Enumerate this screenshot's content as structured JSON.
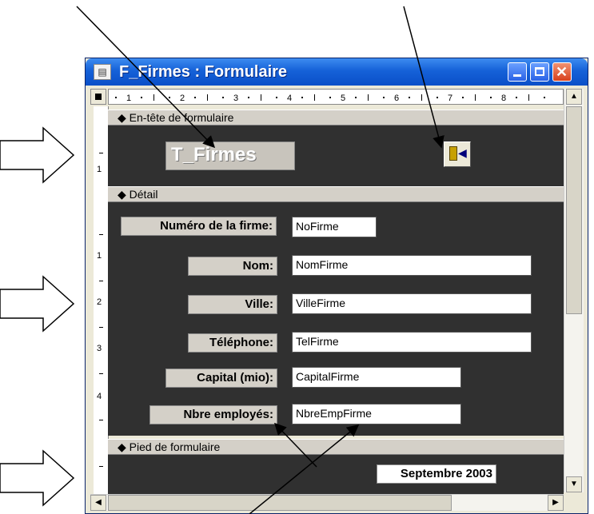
{
  "window": {
    "title": "F_Firmes : Formulaire",
    "icon": "form-icon"
  },
  "ruler": {
    "ticks": [
      "1",
      "2",
      "3",
      "4",
      "5",
      "6",
      "7",
      "8"
    ],
    "vticks": [
      "1",
      "1",
      "2",
      "3",
      "4"
    ]
  },
  "sections": {
    "header": "En-tête de formulaire",
    "detail": "Détail",
    "footer": "Pied de formulaire"
  },
  "header": {
    "title_label": "T_Firmes",
    "exit_icon": "exit-door-icon"
  },
  "fields": [
    {
      "label": "Numéro de la firme:",
      "value": "NoFirme"
    },
    {
      "label": "Nom:",
      "value": "NomFirme"
    },
    {
      "label": "Ville:",
      "value": "VilleFirme"
    },
    {
      "label": "Téléphone:",
      "value": "TelFirme"
    },
    {
      "label": "Capital (mio):",
      "value": "CapitalFirme"
    },
    {
      "label": "Nbre employés:",
      "value": "NbreEmpFirme"
    }
  ],
  "footer": {
    "date_label": "Septembre 2003"
  },
  "colors": {
    "titlebar": "#0a4fc8",
    "design_grid": "#d4d0c8"
  }
}
